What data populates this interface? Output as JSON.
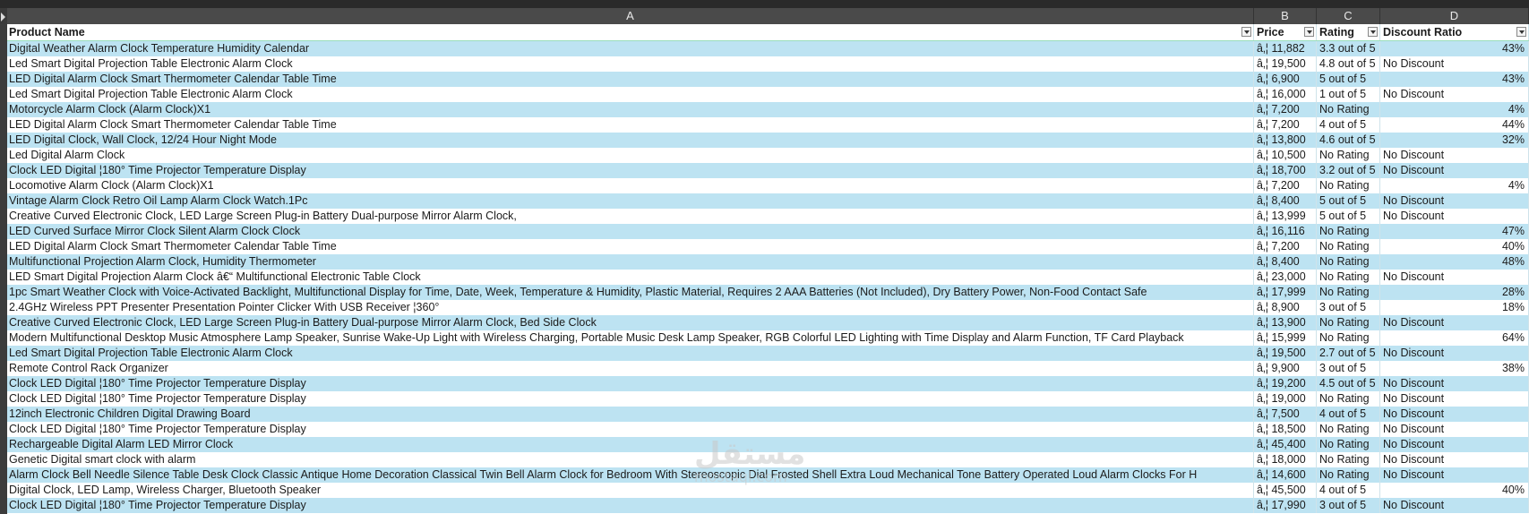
{
  "columns": [
    "A",
    "B",
    "C",
    "D"
  ],
  "headers": {
    "product": "Product Name",
    "price": "Price",
    "rating": "Rating",
    "discount": "Discount Ratio"
  },
  "rows": [
    {
      "name": "Digital Weather Alarm Clock Temperature Humidity Calendar",
      "price": "â‚¦ 11,882",
      "rating": "3.3 out of 5",
      "discount": "43%"
    },
    {
      "name": "Led Smart Digital Projection Table Electronic Alarm Clock",
      "price": "â‚¦ 19,500",
      "rating": "4.8 out of 5",
      "discount": "No Discount"
    },
    {
      "name": "LED Digital Alarm Clock Smart Thermometer Calendar Table Time",
      "price": "â‚¦ 6,900",
      "rating": "5 out of 5",
      "discount": "43%"
    },
    {
      "name": "Led Smart Digital Projection Table Electronic Alarm Clock",
      "price": "â‚¦ 16,000",
      "rating": "1 out of 5",
      "discount": "No Discount"
    },
    {
      "name": "Motorcycle Alarm Clock (Alarm Clock)X1",
      "price": "â‚¦ 7,200",
      "rating": "No Rating",
      "discount": "4%"
    },
    {
      "name": "LED Digital Alarm Clock Smart Thermometer Calendar Table Time",
      "price": "â‚¦ 7,200",
      "rating": "4 out of 5",
      "discount": "44%"
    },
    {
      "name": "LED Digital Clock, Wall Clock, 12/24 Hour Night Mode",
      "price": "â‚¦ 13,800",
      "rating": "4.6 out of 5",
      "discount": "32%"
    },
    {
      "name": "Led Digital Alarm Clock",
      "price": "â‚¦ 10,500",
      "rating": "No Rating",
      "discount": "No Discount"
    },
    {
      "name": "Clock LED Digital ¦180° Time Projector Temperature Display",
      "price": "â‚¦ 18,700",
      "rating": "3.2 out of 5",
      "discount": "No Discount"
    },
    {
      "name": "Locomotive Alarm Clock (Alarm Clock)X1",
      "price": "â‚¦ 7,200",
      "rating": "No Rating",
      "discount": "4%"
    },
    {
      "name": "Vintage Alarm Clock Retro Oil Lamp Alarm Clock Watch.1Pc",
      "price": "â‚¦ 8,400",
      "rating": "5 out of 5",
      "discount": "No Discount"
    },
    {
      "name": "Creative Curved Electronic Clock, LED Large Screen Plug-in Battery Dual-purpose Mirror Alarm Clock,",
      "price": "â‚¦ 13,999",
      "rating": "5 out of 5",
      "discount": "No Discount"
    },
    {
      "name": "LED Curved Surface Mirror Clock Silent Alarm Clock Clock",
      "price": "â‚¦ 16,116",
      "rating": "No Rating",
      "discount": "47%"
    },
    {
      "name": "LED Digital Alarm Clock Smart Thermometer Calendar Table Time",
      "price": "â‚¦ 7,200",
      "rating": "No Rating",
      "discount": "40%"
    },
    {
      "name": "Multifunctional Projection Alarm Clock, Humidity Thermometer",
      "price": "â‚¦ 8,400",
      "rating": "No Rating",
      "discount": "48%"
    },
    {
      "name": "LED Smart Digital Projection Alarm Clock â€“ Multifunctional Electronic Table Clock",
      "price": "â‚¦ 23,000",
      "rating": "No Rating",
      "discount": "No Discount"
    },
    {
      "name": "1pc Smart Weather Clock with Voice-Activated Backlight, Multifunctional Display for Time, Date, Week, Temperature & Humidity, Plastic Material, Requires 2 AAA Batteries (Not Included), Dry Battery Power, Non-Food Contact Safe",
      "price": "â‚¦ 17,999",
      "rating": "No Rating",
      "discount": "28%"
    },
    {
      "name": "2.4GHz Wireless PPT Presenter Presentation Pointer Clicker With USB Receiver ¦360°",
      "price": "â‚¦ 8,900",
      "rating": "3 out of 5",
      "discount": "18%"
    },
    {
      "name": "Creative Curved Electronic Clock, LED Large Screen Plug-in Battery Dual-purpose Mirror Alarm Clock, Bed Side Clock",
      "price": "â‚¦ 13,900",
      "rating": "No Rating",
      "discount": "No Discount"
    },
    {
      "name": "Modern Multifunctional Desktop Music Atmosphere Lamp Speaker, Sunrise Wake-Up Light with Wireless Charging, Portable Music Desk Lamp Speaker, RGB Colorful LED Lighting with Time Display and Alarm Function, TF Card Playback",
      "price": "â‚¦ 15,999",
      "rating": "No Rating",
      "discount": "64%"
    },
    {
      "name": "Led Smart Digital Projection Table Electronic Alarm Clock",
      "price": "â‚¦ 19,500",
      "rating": "2.7 out of 5",
      "discount": "No Discount"
    },
    {
      "name": "Remote Control Rack Organizer",
      "price": "â‚¦ 9,900",
      "rating": "3 out of 5",
      "discount": "38%"
    },
    {
      "name": "Clock LED Digital ¦180° Time Projector Temperature Display",
      "price": "â‚¦ 19,200",
      "rating": "4.5 out of 5",
      "discount": "No Discount"
    },
    {
      "name": "Clock LED Digital ¦180° Time Projector Temperature Display",
      "price": "â‚¦ 19,000",
      "rating": "No Rating",
      "discount": "No Discount"
    },
    {
      "name": "12inch Electronic Children Digital Drawing Board",
      "price": "â‚¦ 7,500",
      "rating": "4 out of 5",
      "discount": "No Discount"
    },
    {
      "name": "Clock LED Digital ¦180° Time Projector Temperature Display",
      "price": "â‚¦ 18,500",
      "rating": "No Rating",
      "discount": "No Discount"
    },
    {
      "name": "Rechargeable Digital Alarm LED Mirror Clock",
      "price": "â‚¦ 45,400",
      "rating": "No Rating",
      "discount": "No Discount"
    },
    {
      "name": "Genetic Digital smart clock with alarm",
      "price": "â‚¦ 18,000",
      "rating": "No Rating",
      "discount": "No Discount"
    },
    {
      "name": "Alarm Clock Bell Needle Silence Table Desk Clock Classic Antique Home Decoration Classical Twin Bell Alarm Clock for Bedroom With Stereoscopic Dial Frosted Shell Extra Loud Mechanical Tone Battery Operated Loud Alarm Clocks For H",
      "price": "â‚¦ 14,600",
      "rating": "No Rating",
      "discount": "No Discount"
    },
    {
      "name": "Digital Clock, LED Lamp, Wireless Charger, Bluetooth Speaker",
      "price": "â‚¦ 45,500",
      "rating": "4 out of 5",
      "discount": "40%"
    },
    {
      "name": "Clock LED Digital ¦180° Time Projector Temperature Display",
      "price": "â‚¦ 17,990",
      "rating": "3 out of 5",
      "discount": "No Discount"
    }
  ],
  "watermark": {
    "arabic": "مستقل",
    "latin": "mostaql.com"
  }
}
